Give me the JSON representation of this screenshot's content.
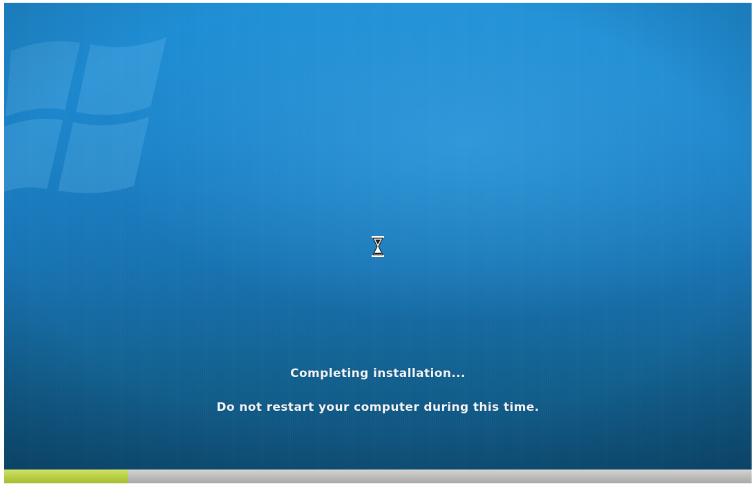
{
  "installer": {
    "status_title": "Completing installation...",
    "status_warning": "Do not restart your computer during this time.",
    "busy_indicator_icon": "hourglass-icon",
    "background_logo_icon": "windows-logo-icon"
  },
  "progress": {
    "fraction_complete": 0.165,
    "fill_color": "#b9cf45",
    "track_color": "#bdbdbb"
  },
  "colors": {
    "background_top": "#1f8fd6",
    "background_bottom": "#0e4f77",
    "text": "#f2f6fa"
  }
}
